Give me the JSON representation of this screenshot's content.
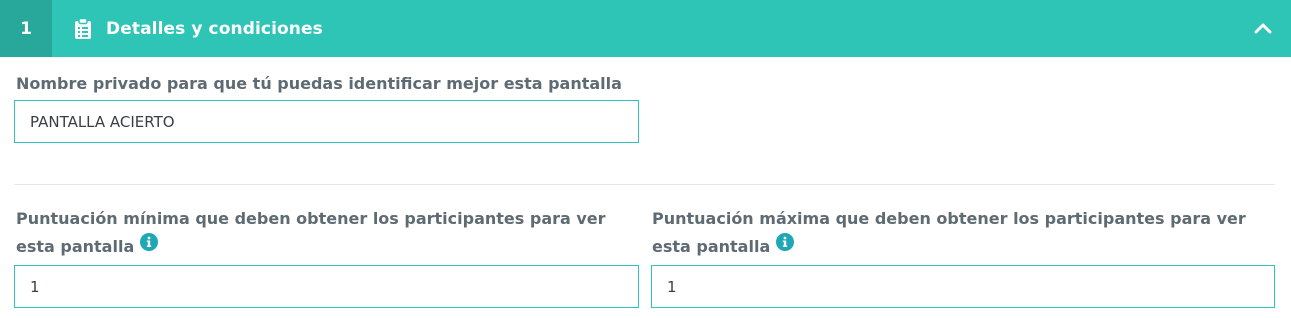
{
  "section": {
    "number": "1",
    "title": "Detalles y condiciones",
    "icon": "clipboard-icon",
    "toggle_icon": "chevron-up-icon",
    "accent_color": "#2ec4b6"
  },
  "fields": {
    "private_name": {
      "label": "Nombre privado para que tú puedas identificar mejor esta pantalla",
      "value": "PANTALLA ACIERTO"
    },
    "min_score": {
      "label_line1": "Puntuación mínima que deben obtener los participantes para ver",
      "label_line2": "esta pantalla",
      "info_icon": "info-icon",
      "value": "1"
    },
    "max_score": {
      "label_line1": "Puntuación máxima que deben obtener los participantes para ver",
      "label_line2": "esta pantalla",
      "info_icon": "info-icon",
      "value": "1"
    }
  }
}
